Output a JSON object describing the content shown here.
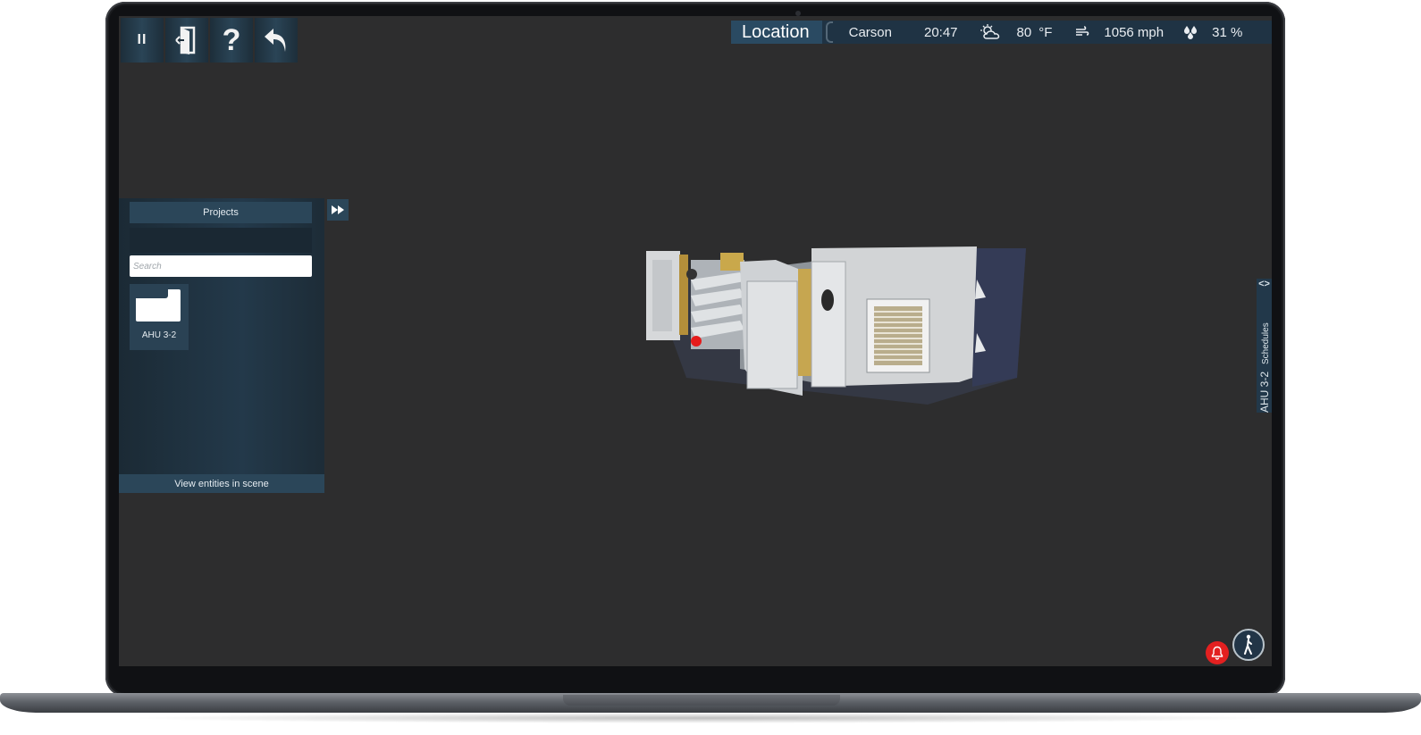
{
  "toolbar": {
    "pause_label": "II",
    "help_label": "?"
  },
  "status": {
    "location_label": "Location",
    "city": "Carson",
    "time": "20:47",
    "temperature": "80",
    "temperature_unit": "°F",
    "wind_speed": "1056 mph",
    "humidity": "31 %"
  },
  "projects_panel": {
    "header": "Projects",
    "search_placeholder": "Search",
    "items": [
      {
        "label": "AHU 3-2"
      }
    ],
    "footer": "View entities in scene"
  },
  "side_tab": {
    "arrows": "<>",
    "title": "AHU 3-2",
    "subtitle": "Schedules"
  },
  "colors": {
    "screen_bg": "#2d2d2e",
    "panel_bg": "#23394a",
    "accent": "#2b4659",
    "alarm": "#e32020"
  }
}
